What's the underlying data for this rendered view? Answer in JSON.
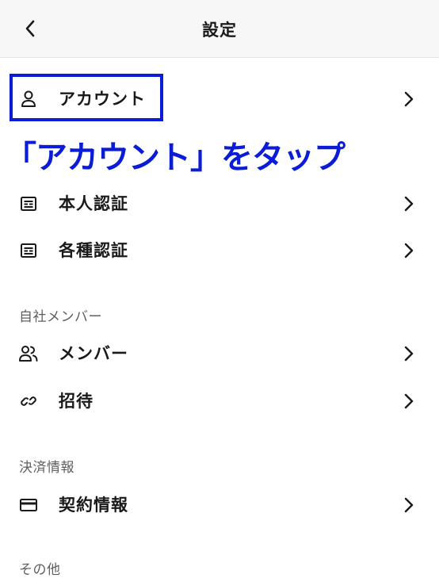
{
  "header": {
    "title": "設定"
  },
  "account": {
    "label": "アカウント"
  },
  "annotation": {
    "text": "「アカウント」をタップ",
    "color": "#0a1cd6"
  },
  "verification": {
    "items": [
      {
        "label": "本人認証",
        "icon": "id-card-icon"
      },
      {
        "label": "各種認証",
        "icon": "id-card-icon"
      }
    ]
  },
  "members_section": {
    "title": "自社メンバー",
    "items": [
      {
        "label": "メンバー",
        "icon": "people-icon"
      },
      {
        "label": "招待",
        "icon": "link-icon"
      }
    ]
  },
  "payment_section": {
    "title": "決済情報",
    "items": [
      {
        "label": "契約情報",
        "icon": "credit-card-icon"
      }
    ]
  },
  "other_section": {
    "title": "その他"
  }
}
